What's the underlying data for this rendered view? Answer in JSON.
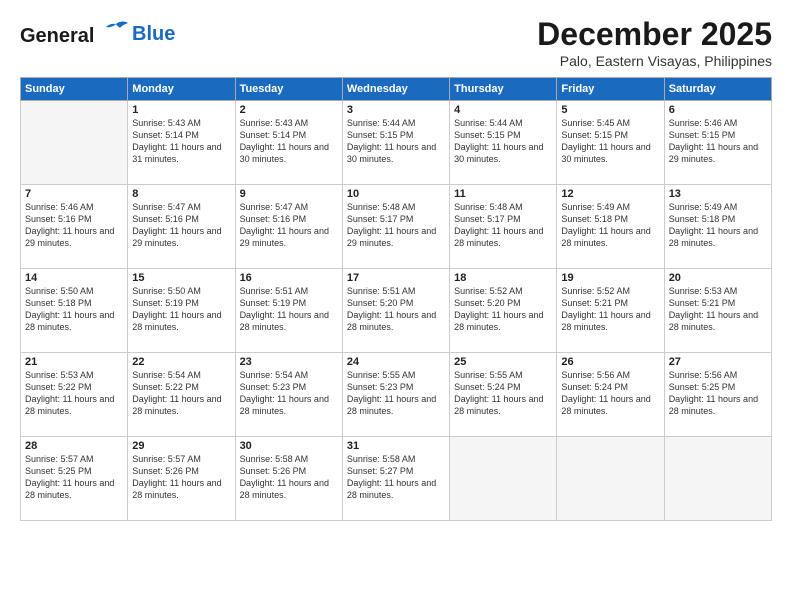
{
  "header": {
    "logo_line1": "General",
    "logo_line2": "Blue",
    "month_title": "December 2025",
    "location": "Palo, Eastern Visayas, Philippines"
  },
  "days_of_week": [
    "Sunday",
    "Monday",
    "Tuesday",
    "Wednesday",
    "Thursday",
    "Friday",
    "Saturday"
  ],
  "weeks": [
    [
      {
        "day": "",
        "sunrise": "",
        "sunset": "",
        "daylight": ""
      },
      {
        "day": "1",
        "sunrise": "Sunrise: 5:43 AM",
        "sunset": "Sunset: 5:14 PM",
        "daylight": "Daylight: 11 hours and 31 minutes."
      },
      {
        "day": "2",
        "sunrise": "Sunrise: 5:43 AM",
        "sunset": "Sunset: 5:14 PM",
        "daylight": "Daylight: 11 hours and 30 minutes."
      },
      {
        "day": "3",
        "sunrise": "Sunrise: 5:44 AM",
        "sunset": "Sunset: 5:15 PM",
        "daylight": "Daylight: 11 hours and 30 minutes."
      },
      {
        "day": "4",
        "sunrise": "Sunrise: 5:44 AM",
        "sunset": "Sunset: 5:15 PM",
        "daylight": "Daylight: 11 hours and 30 minutes."
      },
      {
        "day": "5",
        "sunrise": "Sunrise: 5:45 AM",
        "sunset": "Sunset: 5:15 PM",
        "daylight": "Daylight: 11 hours and 30 minutes."
      },
      {
        "day": "6",
        "sunrise": "Sunrise: 5:46 AM",
        "sunset": "Sunset: 5:15 PM",
        "daylight": "Daylight: 11 hours and 29 minutes."
      }
    ],
    [
      {
        "day": "7",
        "sunrise": "Sunrise: 5:46 AM",
        "sunset": "Sunset: 5:16 PM",
        "daylight": "Daylight: 11 hours and 29 minutes."
      },
      {
        "day": "8",
        "sunrise": "Sunrise: 5:47 AM",
        "sunset": "Sunset: 5:16 PM",
        "daylight": "Daylight: 11 hours and 29 minutes."
      },
      {
        "day": "9",
        "sunrise": "Sunrise: 5:47 AM",
        "sunset": "Sunset: 5:16 PM",
        "daylight": "Daylight: 11 hours and 29 minutes."
      },
      {
        "day": "10",
        "sunrise": "Sunrise: 5:48 AM",
        "sunset": "Sunset: 5:17 PM",
        "daylight": "Daylight: 11 hours and 29 minutes."
      },
      {
        "day": "11",
        "sunrise": "Sunrise: 5:48 AM",
        "sunset": "Sunset: 5:17 PM",
        "daylight": "Daylight: 11 hours and 28 minutes."
      },
      {
        "day": "12",
        "sunrise": "Sunrise: 5:49 AM",
        "sunset": "Sunset: 5:18 PM",
        "daylight": "Daylight: 11 hours and 28 minutes."
      },
      {
        "day": "13",
        "sunrise": "Sunrise: 5:49 AM",
        "sunset": "Sunset: 5:18 PM",
        "daylight": "Daylight: 11 hours and 28 minutes."
      }
    ],
    [
      {
        "day": "14",
        "sunrise": "Sunrise: 5:50 AM",
        "sunset": "Sunset: 5:18 PM",
        "daylight": "Daylight: 11 hours and 28 minutes."
      },
      {
        "day": "15",
        "sunrise": "Sunrise: 5:50 AM",
        "sunset": "Sunset: 5:19 PM",
        "daylight": "Daylight: 11 hours and 28 minutes."
      },
      {
        "day": "16",
        "sunrise": "Sunrise: 5:51 AM",
        "sunset": "Sunset: 5:19 PM",
        "daylight": "Daylight: 11 hours and 28 minutes."
      },
      {
        "day": "17",
        "sunrise": "Sunrise: 5:51 AM",
        "sunset": "Sunset: 5:20 PM",
        "daylight": "Daylight: 11 hours and 28 minutes."
      },
      {
        "day": "18",
        "sunrise": "Sunrise: 5:52 AM",
        "sunset": "Sunset: 5:20 PM",
        "daylight": "Daylight: 11 hours and 28 minutes."
      },
      {
        "day": "19",
        "sunrise": "Sunrise: 5:52 AM",
        "sunset": "Sunset: 5:21 PM",
        "daylight": "Daylight: 11 hours and 28 minutes."
      },
      {
        "day": "20",
        "sunrise": "Sunrise: 5:53 AM",
        "sunset": "Sunset: 5:21 PM",
        "daylight": "Daylight: 11 hours and 28 minutes."
      }
    ],
    [
      {
        "day": "21",
        "sunrise": "Sunrise: 5:53 AM",
        "sunset": "Sunset: 5:22 PM",
        "daylight": "Daylight: 11 hours and 28 minutes."
      },
      {
        "day": "22",
        "sunrise": "Sunrise: 5:54 AM",
        "sunset": "Sunset: 5:22 PM",
        "daylight": "Daylight: 11 hours and 28 minutes."
      },
      {
        "day": "23",
        "sunrise": "Sunrise: 5:54 AM",
        "sunset": "Sunset: 5:23 PM",
        "daylight": "Daylight: 11 hours and 28 minutes."
      },
      {
        "day": "24",
        "sunrise": "Sunrise: 5:55 AM",
        "sunset": "Sunset: 5:23 PM",
        "daylight": "Daylight: 11 hours and 28 minutes."
      },
      {
        "day": "25",
        "sunrise": "Sunrise: 5:55 AM",
        "sunset": "Sunset: 5:24 PM",
        "daylight": "Daylight: 11 hours and 28 minutes."
      },
      {
        "day": "26",
        "sunrise": "Sunrise: 5:56 AM",
        "sunset": "Sunset: 5:24 PM",
        "daylight": "Daylight: 11 hours and 28 minutes."
      },
      {
        "day": "27",
        "sunrise": "Sunrise: 5:56 AM",
        "sunset": "Sunset: 5:25 PM",
        "daylight": "Daylight: 11 hours and 28 minutes."
      }
    ],
    [
      {
        "day": "28",
        "sunrise": "Sunrise: 5:57 AM",
        "sunset": "Sunset: 5:25 PM",
        "daylight": "Daylight: 11 hours and 28 minutes."
      },
      {
        "day": "29",
        "sunrise": "Sunrise: 5:57 AM",
        "sunset": "Sunset: 5:26 PM",
        "daylight": "Daylight: 11 hours and 28 minutes."
      },
      {
        "day": "30",
        "sunrise": "Sunrise: 5:58 AM",
        "sunset": "Sunset: 5:26 PM",
        "daylight": "Daylight: 11 hours and 28 minutes."
      },
      {
        "day": "31",
        "sunrise": "Sunrise: 5:58 AM",
        "sunset": "Sunset: 5:27 PM",
        "daylight": "Daylight: 11 hours and 28 minutes."
      },
      {
        "day": "",
        "sunrise": "",
        "sunset": "",
        "daylight": ""
      },
      {
        "day": "",
        "sunrise": "",
        "sunset": "",
        "daylight": ""
      },
      {
        "day": "",
        "sunrise": "",
        "sunset": "",
        "daylight": ""
      }
    ]
  ]
}
